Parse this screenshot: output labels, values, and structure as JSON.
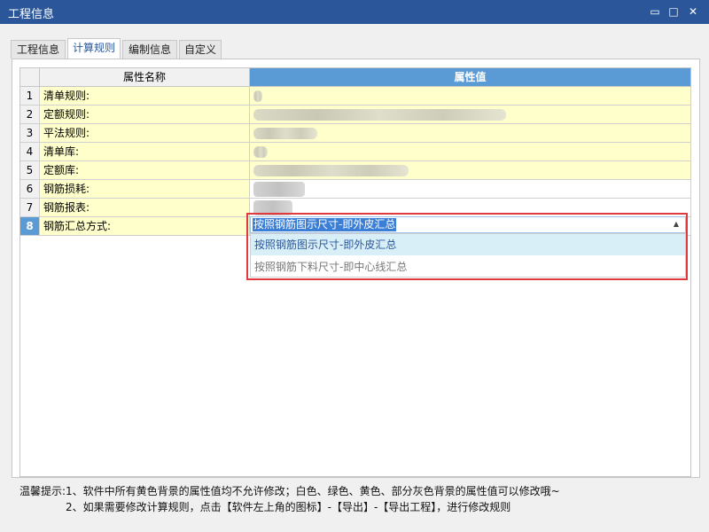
{
  "window": {
    "title": "工程信息",
    "minimize": "▭",
    "maximize": "□",
    "close": "✕"
  },
  "tabs": [
    "工程信息",
    "计算规则",
    "编制信息",
    "自定义"
  ],
  "active_tab": "计算规则",
  "grid": {
    "headers": {
      "name": "属性名称",
      "value": "属性值"
    },
    "rows": [
      {
        "index": "1",
        "name": "清单规则:"
      },
      {
        "index": "2",
        "name": "定额规则:"
      },
      {
        "index": "3",
        "name": "平法规则:"
      },
      {
        "index": "4",
        "name": "清单库:"
      },
      {
        "index": "5",
        "name": "定额库:"
      },
      {
        "index": "6",
        "name": "钢筋损耗:"
      },
      {
        "index": "7",
        "name": "钢筋报表:"
      },
      {
        "index": "8",
        "name": "钢筋汇总方式:"
      }
    ]
  },
  "combo": {
    "value": "按照钢筋图示尺寸-即外皮汇总",
    "options": [
      "按照钢筋图示尺寸-即外皮汇总",
      "按照钢筋下料尺寸-即中心线汇总"
    ]
  },
  "footer": {
    "line1": "温馨提示:1、软件中所有黄色背景的属性值均不允许修改；白色、绿色、黄色、部分灰色背景的属性值可以修改哦~",
    "line2": "2、如果需要修改计算规则，点击【软件左上角的图标】-【导出】-【导出工程】，进行修改规则"
  },
  "colors": {
    "titlebar": "#2b579a",
    "header_value": "#5b9bd5",
    "readonly_cell": "#ffffcc",
    "highlight_box": "#e0393e"
  }
}
